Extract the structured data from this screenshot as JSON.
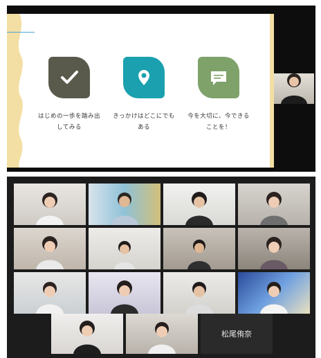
{
  "slide": {
    "items": [
      {
        "icon": "check-icon",
        "color": "#5a5a4c",
        "caption": "はじめの一歩を踏み出\nしてみる"
      },
      {
        "icon": "location-pin-icon",
        "color": "#1aa0ae",
        "caption": "きっかけはどこにでも\nある"
      },
      {
        "icon": "speech-bubble-icon",
        "color": "#7fa26b",
        "caption": "今を大切に、今できる\nことを！"
      }
    ]
  },
  "gallery": {
    "name_label": "松尾侑奈"
  }
}
